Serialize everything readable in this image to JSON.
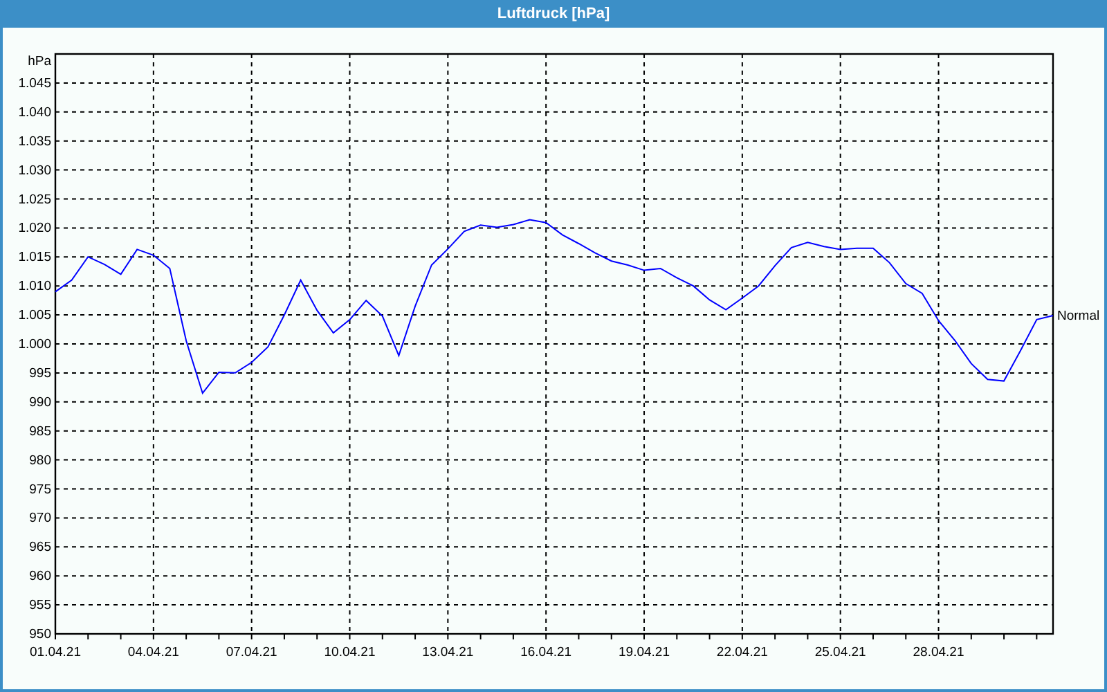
{
  "window": {
    "title": "Luftdruck [hPa]"
  },
  "chart": {
    "chart_data": {
      "type": "line",
      "grid": true,
      "ylabel": "hPa",
      "ylim": [
        950,
        1050
      ],
      "categories": [
        "01.04.21",
        null,
        null,
        null,
        null,
        null,
        "04.04.21",
        null,
        null,
        null,
        null,
        null,
        "07.04.21",
        null,
        null,
        null,
        null,
        null,
        "10.04.21",
        null,
        null,
        null,
        null,
        null,
        "13.04.21",
        null,
        null,
        null,
        null,
        null,
        "16.04.21",
        null,
        null,
        null,
        null,
        null,
        "19.04.21",
        null,
        null,
        null,
        null,
        null,
        "22.04.21",
        null,
        null,
        null,
        null,
        null,
        "25.04.21",
        null,
        null,
        null,
        null,
        null,
        "28.04.21",
        null,
        null,
        null,
        null,
        null,
        null,
        null
      ],
      "yticks": [
        950,
        955,
        960,
        965,
        970,
        975,
        980,
        985,
        990,
        995,
        {
          "value": 1000,
          "label": "1.000"
        },
        {
          "value": 1005,
          "label": "1.005"
        },
        {
          "value": 1010,
          "label": "1.010"
        },
        {
          "value": 1015,
          "label": "1.015"
        },
        {
          "value": 1020,
          "label": "1.020"
        },
        {
          "value": 1025,
          "label": "1.025"
        },
        {
          "value": 1030,
          "label": "1.030"
        },
        {
          "value": 1035,
          "label": "1.035"
        },
        {
          "value": 1040,
          "label": "1.040"
        },
        {
          "value": 1045,
          "label": "1.045"
        }
      ],
      "series": [
        {
          "name": "Normal",
          "color": "#0000ff",
          "values": [
            1009,
            1011,
            1015,
            1013.7,
            1012,
            1016.3,
            1015.3,
            1013,
            1000.5,
            991.5,
            995.1,
            995,
            996.8,
            999.5,
            1005,
            1011,
            1005.8,
            1001.9,
            1004.2,
            1007.5,
            1004.8,
            998,
            1006.5,
            1013.6,
            1016.4,
            1019.4,
            1020.5,
            1020.1,
            1020.6,
            1021.4,
            1020.9,
            1018.8,
            1017.3,
            1015.7,
            1014.3,
            1013.6,
            1012.7,
            1013,
            1011.4,
            1010,
            1007.6,
            1005.9,
            1007.9,
            1010,
            1013.5,
            1016.6,
            1017.5,
            1016.8,
            1016.3,
            1016.5,
            1016.5,
            1014,
            1010.4,
            1008.7,
            1004,
            1000.6,
            996.6,
            993.9,
            993.6,
            998.8,
            1004.2,
            1004.9
          ]
        }
      ]
    }
  }
}
